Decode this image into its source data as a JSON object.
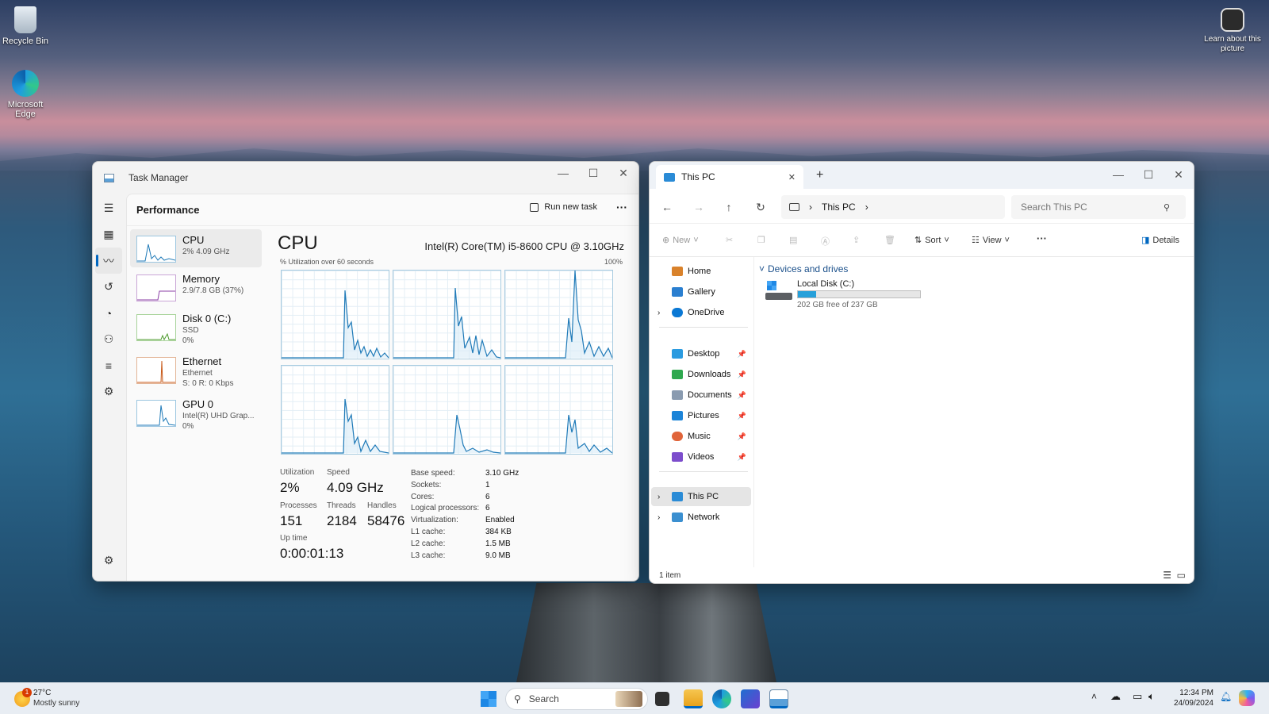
{
  "desktop": {
    "icons": [
      {
        "label": "Recycle Bin"
      },
      {
        "label": "Microsoft Edge"
      }
    ],
    "learn_about": "Learn about this picture"
  },
  "task_manager": {
    "title": "Task Manager",
    "section": "Performance",
    "run_new_task": "Run new task",
    "more": "···",
    "sidebar": [
      {
        "name": "CPU",
        "line1": "2% 4.09 GHz",
        "line2": ""
      },
      {
        "name": "Memory",
        "line1": "2.9/7.8 GB (37%)",
        "line2": ""
      },
      {
        "name": "Disk 0 (C:)",
        "line1": "SSD",
        "line2": "0%"
      },
      {
        "name": "Ethernet",
        "line1": "Ethernet",
        "line2": "S: 0 R: 0 Kbps"
      },
      {
        "name": "GPU 0",
        "line1": "Intel(R) UHD Grap...",
        "line2": "0%"
      }
    ],
    "cpu_title": "CPU",
    "cpu_model": "Intel(R) Core(TM) i5-8600 CPU @ 3.10GHz",
    "graph_caption": "% Utilization over 60 seconds",
    "graph_max": "100%",
    "stats": {
      "utilization_label": "Utilization",
      "utilization": "2%",
      "speed_label": "Speed",
      "speed": "4.09 GHz",
      "processes_label": "Processes",
      "processes": "151",
      "threads_label": "Threads",
      "threads": "2184",
      "handles_label": "Handles",
      "handles": "58476",
      "uptime_label": "Up time",
      "uptime": "0:00:01:13"
    },
    "specs": [
      {
        "k": "Base speed:",
        "v": "3.10 GHz"
      },
      {
        "k": "Sockets:",
        "v": "1"
      },
      {
        "k": "Cores:",
        "v": "6"
      },
      {
        "k": "Logical processors:",
        "v": "6"
      },
      {
        "k": "Virtualization:",
        "v": "Enabled"
      },
      {
        "k": "L1 cache:",
        "v": "384 KB"
      },
      {
        "k": "L2 cache:",
        "v": "1.5 MB"
      },
      {
        "k": "L3 cache:",
        "v": "9.0 MB"
      }
    ]
  },
  "explorer": {
    "tab": "This PC",
    "breadcrumb": "This PC",
    "search_placeholder": "Search This PC",
    "toolbar": {
      "new": "New",
      "sort": "Sort",
      "view": "View",
      "details": "Details",
      "more": "···"
    },
    "nav": {
      "home": "Home",
      "gallery": "Gallery",
      "onedrive": "OneDrive",
      "desktop": "Desktop",
      "downloads": "Downloads",
      "documents": "Documents",
      "pictures": "Pictures",
      "music": "Music",
      "videos": "Videos",
      "thispc": "This PC",
      "network": "Network"
    },
    "group": "Devices and drives",
    "drive": {
      "name": "Local Disk (C:)",
      "free": "202 GB free of 237 GB",
      "used_fraction": 0.15
    },
    "status": "1 item"
  },
  "taskbar": {
    "weather_temp": "27°C",
    "weather_desc": "Mostly sunny",
    "weather_badge": "1",
    "search": "Search",
    "time": "12:34 PM",
    "date": "24/09/2024"
  },
  "colors": {
    "accent": "#0067c0",
    "graph": "#1f7ab8",
    "memory": "#8b3fa6",
    "disk": "#4a9a2a",
    "ethernet": "#c85a1a"
  }
}
